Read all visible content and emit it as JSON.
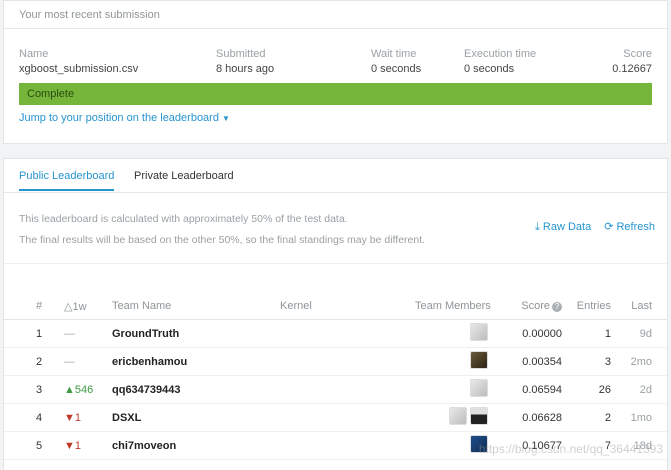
{
  "submission": {
    "header": "Your most recent submission",
    "cols": [
      {
        "label": "Name",
        "value": "xgboost_submission.csv"
      },
      {
        "label": "Submitted",
        "value": "8 hours ago"
      },
      {
        "label": "Wait time",
        "value": "0 seconds"
      },
      {
        "label": "Execution time",
        "value": "0 seconds"
      },
      {
        "label": "Score",
        "value": "0.12667"
      }
    ],
    "status": "Complete",
    "progress": 1.0,
    "progress_color": "#75b63a",
    "jump_link": "Jump to your position on the leaderboard"
  },
  "leaderboard": {
    "tabs": [
      {
        "label": "Public Leaderboard",
        "active": true
      },
      {
        "label": "Private Leaderboard",
        "active": false
      }
    ],
    "info_line1": "This leaderboard is calculated with approximately 50% of the test data.",
    "info_line2": "The final results will be based on the other 50%, so the final standings may be different.",
    "actions": [
      {
        "label": "Raw Data",
        "icon": "download-icon"
      },
      {
        "label": "Refresh",
        "icon": "refresh-icon"
      }
    ],
    "columns": [
      "#",
      "△1w",
      "Team Name",
      "Kernel",
      "Team Members",
      "Score",
      "Entries",
      "Last"
    ],
    "rows": [
      {
        "rank": "1",
        "delta": "—",
        "team": "GroundTruth",
        "score": "0.00000",
        "entries": "1",
        "last": "9d"
      },
      {
        "rank": "2",
        "delta": "—",
        "team": "ericbenhamou",
        "score": "0.00354",
        "entries": "3",
        "last": "2mo"
      },
      {
        "rank": "3",
        "delta": "▲546",
        "team": "qq634739443",
        "score": "0.06594",
        "entries": "26",
        "last": "2d"
      },
      {
        "rank": "4",
        "delta": "▼1",
        "team": "DSXL",
        "score": "0.06628",
        "entries": "2",
        "last": "1mo"
      },
      {
        "rank": "5",
        "delta": "▼1",
        "team": "chi7moveon",
        "score": "0.10677",
        "entries": "7",
        "last": "18d"
      }
    ]
  },
  "watermark": "https://blog.csdn.net/qq_36441393"
}
